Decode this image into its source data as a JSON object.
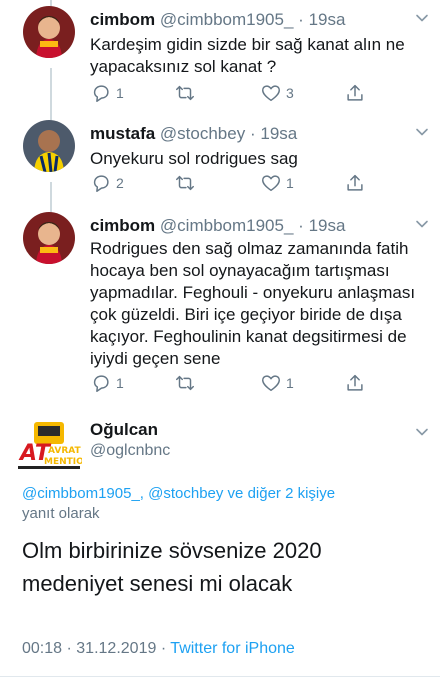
{
  "tweets": [
    {
      "name": "cimbom",
      "handle": "@cimbbom1905_",
      "dot": "·",
      "time": "19sa",
      "text": "Kardeşim gidin sizde bir sağ kanat alın ne yapacaksınız sol kanat ?",
      "replies": "1",
      "retweets": "",
      "likes": "3"
    },
    {
      "name": "mustafa",
      "handle": "@stochbey",
      "dot": "·",
      "time": "19sa",
      "text": "Onyekuru sol rodrigues sag",
      "replies": "2",
      "retweets": "",
      "likes": "1"
    },
    {
      "name": "cimbom",
      "handle": "@cimbbom1905_",
      "dot": "·",
      "time": "19sa",
      "text": "Rodrigues den sağ olmaz zamanında fatih hocaya ben sol oynayacağım tartışması yapmadılar. Feghouli - onyekuru anlaşması çok güzeldi. Biri içe geçiyor biride de dışa kaçıyor. Feghoulinin kanat degsitirmesi de iyiydi geçen sene",
      "replies": "1",
      "retweets": "",
      "likes": "1"
    }
  ],
  "main": {
    "name": "Oğulcan",
    "handle": "@oglcnbnc",
    "avatar_line1": "AT",
    "avatar_line2": "AVRAT",
    "avatar_line3": "MENTION",
    "reply_mentions": "@cimbbom1905_, @stochbey ve diğer 2 kişiye",
    "reply_suffix": "yanıt olarak",
    "text": "Olm birbirinize sövsenize 2020 medeniyet senesi mi olacak",
    "time": "00:18",
    "sep1": "·",
    "date": "31.12.2019",
    "sep2": "·",
    "source": "Twitter for iPhone"
  },
  "colors": {
    "text": "#14171a",
    "secondary": "#657786",
    "link": "#1da1f2",
    "line": "#cfd9de"
  },
  "icons": [
    "reply-icon",
    "retweet-icon",
    "like-icon",
    "share-icon",
    "chevron-down-icon"
  ]
}
